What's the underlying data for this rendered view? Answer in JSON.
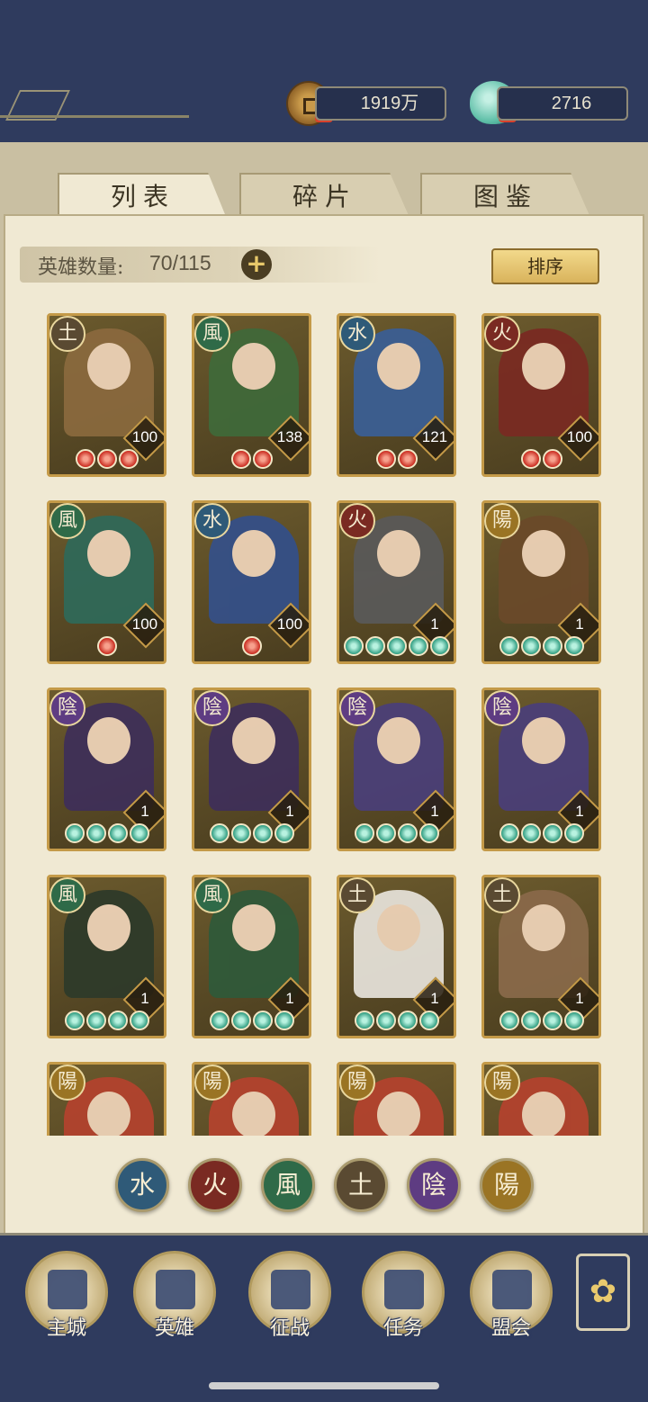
{
  "resources": {
    "coins": "1919万",
    "gems": "2716"
  },
  "tabs": [
    {
      "label": "列表",
      "active": true
    },
    {
      "label": "碎片",
      "active": false
    },
    {
      "label": "图鉴",
      "active": false
    }
  ],
  "hero_count": {
    "label": "英雄数量:",
    "value": "70/115"
  },
  "sort_button": "排序",
  "heroes": [
    {
      "element": "土",
      "level": "100",
      "stars": 3,
      "star_color": "red"
    },
    {
      "element": "風",
      "level": "138",
      "stars": 2,
      "star_color": "red"
    },
    {
      "element": "水",
      "level": "121",
      "stars": 2,
      "star_color": "red"
    },
    {
      "element": "火",
      "level": "100",
      "stars": 2,
      "star_color": "red"
    },
    {
      "element": "風",
      "level": "100",
      "stars": 1,
      "star_color": "red"
    },
    {
      "element": "水",
      "level": "100",
      "stars": 1,
      "star_color": "red"
    },
    {
      "element": "火",
      "level": "1",
      "stars": 5,
      "star_color": "green"
    },
    {
      "element": "陽",
      "level": "1",
      "stars": 4,
      "star_color": "green"
    },
    {
      "element": "陰",
      "level": "1",
      "stars": 4,
      "star_color": "green"
    },
    {
      "element": "陰",
      "level": "1",
      "stars": 4,
      "star_color": "green"
    },
    {
      "element": "陰",
      "level": "1",
      "stars": 4,
      "star_color": "green"
    },
    {
      "element": "陰",
      "level": "1",
      "stars": 4,
      "star_color": "green"
    },
    {
      "element": "風",
      "level": "1",
      "stars": 4,
      "star_color": "green"
    },
    {
      "element": "風",
      "level": "1",
      "stars": 4,
      "star_color": "green"
    },
    {
      "element": "土",
      "level": "1",
      "stars": 4,
      "star_color": "green"
    },
    {
      "element": "土",
      "level": "1",
      "stars": 4,
      "star_color": "green"
    },
    {
      "element": "陽",
      "level": "",
      "stars": 0,
      "star_color": "green"
    },
    {
      "element": "陽",
      "level": "",
      "stars": 0,
      "star_color": "green"
    },
    {
      "element": "陽",
      "level": "",
      "stars": 0,
      "star_color": "green"
    },
    {
      "element": "陽",
      "level": "",
      "stars": 0,
      "star_color": "green"
    }
  ],
  "element_filters": [
    {
      "glyph": "水",
      "color": "#2f5a78"
    },
    {
      "glyph": "火",
      "color": "#7a2a22"
    },
    {
      "glyph": "風",
      "color": "#2f6a48"
    },
    {
      "glyph": "土",
      "color": "#5a4a32"
    },
    {
      "glyph": "陰",
      "color": "#5e3c82"
    },
    {
      "glyph": "陽",
      "color": "#9a7424"
    }
  ],
  "element_colors": {
    "土": "#5a4a32",
    "風": "#2f6a48",
    "水": "#2f5a78",
    "火": "#7a2a22",
    "陰": "#5e3c82",
    "陽": "#9a7424"
  },
  "nav": [
    {
      "label": "主城",
      "icon": "city-gate-icon"
    },
    {
      "label": "英雄",
      "icon": "hero-portrait-icon"
    },
    {
      "label": "征战",
      "icon": "battle-drum-icon"
    },
    {
      "label": "任务",
      "icon": "scroll-task-icon"
    },
    {
      "label": "盟会",
      "icon": "alliance-pavilion-icon"
    }
  ],
  "menu_icon": "flower-menu-icon"
}
